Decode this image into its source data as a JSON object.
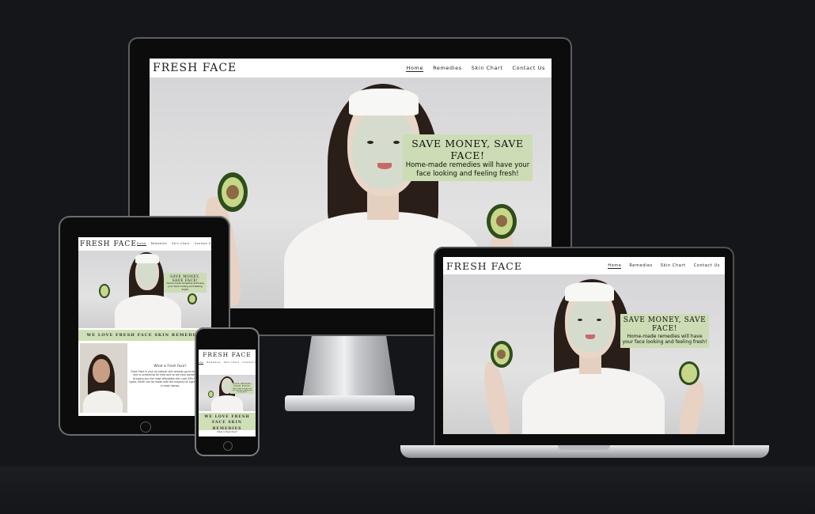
{
  "site": {
    "brand": "FRESH FACE",
    "nav": [
      "Home",
      "Remedies",
      "Skin Chart",
      "Contact Us"
    ],
    "hero_heading": "SAVE MONEY, SAVE FACE!",
    "hero_text": "Home-made remedies will have your face looking and feeling fresh!",
    "banner": "WE LOVE FRESH FACE SKIN REMEDIES",
    "about_heading": "What is Fresh Face?",
    "about_text": "Fresh Face is your all-natural skin remedy go-to for when your skin is screaming for help and so are your pockets! We are bringing you the most affordable skin care DIYs for all skin types, which can be made with the majority of ingredients found in most homes."
  },
  "colors": {
    "background": "#151619",
    "callout": "#ccdcb4",
    "device_frame": "#0c0c0d"
  }
}
